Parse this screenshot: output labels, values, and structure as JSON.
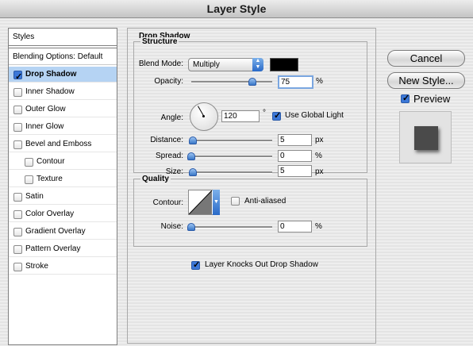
{
  "window": {
    "title": "Layer Style"
  },
  "styles_panel": {
    "header": "Styles",
    "blending_options": "Blending Options: Default",
    "items": [
      {
        "label": "Drop Shadow",
        "checked": true,
        "selected": true,
        "indent": 0
      },
      {
        "label": "Inner Shadow",
        "checked": false,
        "indent": 0
      },
      {
        "label": "Outer Glow",
        "checked": false,
        "indent": 0
      },
      {
        "label": "Inner Glow",
        "checked": false,
        "indent": 0
      },
      {
        "label": "Bevel and Emboss",
        "checked": false,
        "indent": 0
      },
      {
        "label": "Contour",
        "checked": false,
        "indent": 1
      },
      {
        "label": "Texture",
        "checked": false,
        "indent": 1
      },
      {
        "label": "Satin",
        "checked": false,
        "indent": 0
      },
      {
        "label": "Color Overlay",
        "checked": false,
        "indent": 0
      },
      {
        "label": "Gradient Overlay",
        "checked": false,
        "indent": 0
      },
      {
        "label": "Pattern Overlay",
        "checked": false,
        "indent": 0
      },
      {
        "label": "Stroke",
        "checked": false,
        "indent": 0
      }
    ]
  },
  "drop_shadow": {
    "title": "Drop Shadow",
    "structure": {
      "title": "Structure",
      "blend_mode_label": "Blend Mode:",
      "blend_mode_value": "Multiply",
      "shadow_color": "#000000",
      "opacity_label": "Opacity:",
      "opacity_value": "75",
      "opacity_unit": "%",
      "opacity_slider": 0.75,
      "angle_label": "Angle:",
      "angle_value": "120",
      "angle_unit": "°",
      "use_global_light_label": "Use Global Light",
      "use_global_light_checked": true,
      "distance_label": "Distance:",
      "distance_value": "5",
      "distance_unit": "px",
      "distance_slider": 0.02,
      "spread_label": "Spread:",
      "spread_value": "0",
      "spread_unit": "%",
      "spread_slider": 0.0,
      "size_label": "Size:",
      "size_value": "5",
      "size_unit": "px",
      "size_slider": 0.02
    },
    "quality": {
      "title": "Quality",
      "contour_label": "Contour:",
      "anti_aliased_label": "Anti-aliased",
      "anti_aliased_checked": false,
      "noise_label": "Noise:",
      "noise_value": "0",
      "noise_unit": "%",
      "noise_slider": 0.0
    },
    "layer_knocks_out_label": "Layer Knocks Out Drop Shadow",
    "layer_knocks_out_checked": true
  },
  "buttons": {
    "cancel": "Cancel",
    "new_style": "New Style...",
    "preview_label": "Preview",
    "preview_checked": true
  },
  "colors": {
    "accent": "#3a78c8",
    "selection": "#b5d3f3"
  }
}
